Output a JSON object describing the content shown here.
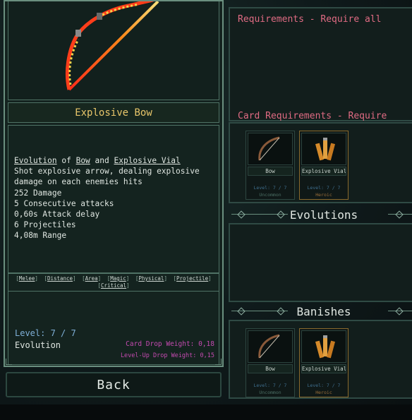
{
  "item": {
    "name": "Explosive Bow",
    "description": {
      "word_evolution": "Evolution",
      "word_of": " of ",
      "word_bow": "Bow",
      "word_and": " and ",
      "word_vial": "Explosive Vial",
      "line1": "Shot explosive arrow, dealing explosive",
      "line2": "damage on each enemies hits",
      "stat1": "252 Damage",
      "stat2": "5 Consecutive attacks",
      "stat3": "0,60s Attack delay",
      "stat4": "6 Projectiles",
      "stat5": "4,08m Range"
    },
    "tags": [
      "Melee",
      "Distance",
      "Area",
      "Magic",
      "Physical",
      "Projectile",
      "Critical"
    ],
    "level": "Level: 7 / 7",
    "rarity": "Evolution",
    "card_drop_weight": "Card Drop Weight: 0,18",
    "levelup_drop_weight": "Level-Up Drop Weight: 0,15"
  },
  "back_button": "Back",
  "requirements": {
    "title": "Requirements - Require all",
    "card_title": "Card Requirements - Require"
  },
  "cards": [
    {
      "name": "Bow",
      "level": "Level: 7 / 7",
      "rarity": "Uncommon",
      "icon": "bow-icon"
    },
    {
      "name": "Explosive Vial",
      "level": "Level: 7 / 7",
      "rarity": "Heroic",
      "icon": "vials-icon"
    }
  ],
  "sections": {
    "evolutions": "Evolutions",
    "banishes": "Banishes"
  },
  "colors": {
    "title_gold": "#e8c66a",
    "requirement_red": "#e06b83",
    "level_blue": "#7fb0d8",
    "weight_magenta": "#c44ab0",
    "border_green": "#6a8f7f"
  }
}
